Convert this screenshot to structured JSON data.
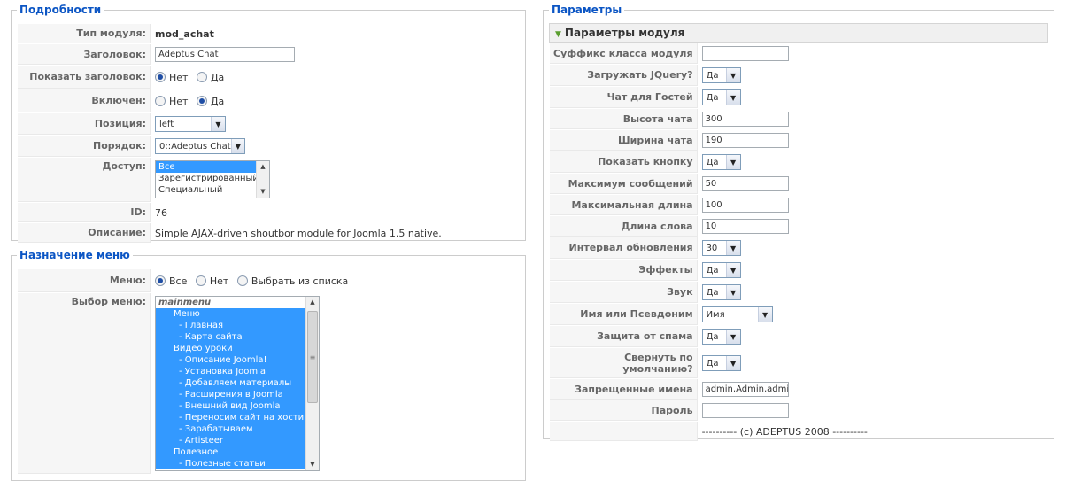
{
  "details": {
    "legend": "Подробности",
    "module_type_label": "Тип модуля:",
    "module_type_value": "mod_achat",
    "title_label": "Заголовок:",
    "title_value": "Adeptus Chat",
    "show_title_label": "Показать заголовок:",
    "enabled_label": "Включен:",
    "no": "Нет",
    "yes": "Да",
    "position_label": "Позиция:",
    "position_value": "left",
    "order_label": "Порядок:",
    "order_value": "0::Adeptus Chat",
    "access_label": "Доступ:",
    "access_options": [
      "Все",
      "Зарегистрированный",
      "Специальный"
    ],
    "id_label": "ID:",
    "id_value": "76",
    "description_label": "Описание:",
    "description_value": "Simple AJAX-driven shoutbor module for Joomla 1.5 native."
  },
  "menu_assignment": {
    "legend": "Назначение меню",
    "menus_label": "Меню:",
    "opt_all": "Все",
    "opt_none": "Нет",
    "opt_select": "Выбрать из списка",
    "menu_select_label": "Выбор меню:",
    "list_header": "mainmenu",
    "list_items": [
      "Меню",
      "- Главная",
      "- Карта сайта",
      "Видео уроки",
      "- Описание Joomla!",
      "- Установка Joomla",
      "- Добавляем материалы",
      "- Расширения в Joomla",
      "- Внешний вид Joomla",
      "- Переносим сайт на хостинг",
      "- Зарабатываем",
      "- Artisteer",
      "Полезное",
      "- Полезные статьи"
    ]
  },
  "params": {
    "legend": "Параметры",
    "panel_title": "Параметры модуля",
    "rows": [
      {
        "label": "Суффикс класса модуля",
        "type": "input",
        "value": ""
      },
      {
        "label": "Загружать JQuery?",
        "type": "select",
        "value": "Да"
      },
      {
        "label": "Чат для Гостей",
        "type": "select",
        "value": "Да"
      },
      {
        "label": "Высота чата",
        "type": "input",
        "value": "300"
      },
      {
        "label": "Ширина чата",
        "type": "input",
        "value": "190"
      },
      {
        "label": "Показать кнопку",
        "type": "select",
        "value": "Да"
      },
      {
        "label": "Максимум сообщений",
        "type": "input",
        "value": "50"
      },
      {
        "label": "Максимальная длина",
        "type": "input",
        "value": "100"
      },
      {
        "label": "Длина слова",
        "type": "input",
        "value": "10"
      },
      {
        "label": "Интервал обновления",
        "type": "select",
        "value": "30"
      },
      {
        "label": "Эффекты",
        "type": "select",
        "value": "Да"
      },
      {
        "label": "Звук",
        "type": "select",
        "value": "Да"
      },
      {
        "label": "Имя или Псевдоним",
        "type": "select_wide",
        "value": "Имя"
      },
      {
        "label": "Защита от спама",
        "type": "select",
        "value": "Да"
      },
      {
        "label": "Свернуть по умолчанию?",
        "type": "select",
        "value": "Да"
      },
      {
        "label": "Запрещенные имена",
        "type": "input",
        "value": "admin,Admin,adminis"
      },
      {
        "label": "Пароль",
        "type": "input",
        "value": ""
      }
    ],
    "footer": "---------- (c) ADEPTUS 2008 ----------"
  }
}
